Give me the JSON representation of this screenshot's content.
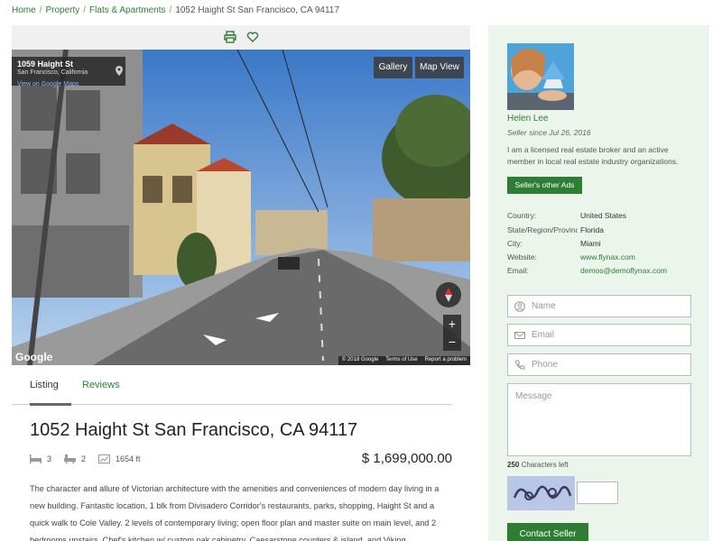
{
  "breadcrumb": {
    "home": "Home",
    "property": "Property",
    "category": "Flats & Apartments",
    "current": "1052 Haight St San Francisco, CA 94117",
    "separator": "/"
  },
  "map": {
    "address_line1": "1059 Haight St",
    "address_line2": "San Francisco, California",
    "view_link": "View on Google Maps",
    "gallery_label": "Gallery",
    "mapview_label": "Map View",
    "zoom_in": "+",
    "zoom_out": "−",
    "logo": "Google",
    "attrib_copyright": "© 2018 Google",
    "attrib_terms": "Terms of Use",
    "attrib_report": "Report a problem"
  },
  "tabs": [
    {
      "label": "Listing",
      "active": true
    },
    {
      "label": "Reviews",
      "active": false
    }
  ],
  "listing": {
    "title": "1052 Haight St San Francisco, CA 94117",
    "beds": "3",
    "baths": "2",
    "area": "1654 ft",
    "price": "$ 1,699,000.00",
    "description": "The character and allure of Victorian architecture with the amenities and conveniences of modern day living in a new building. Fantastic location, 1 blk from Divisadero Corridor's restaurants, parks, shopping, Haight St and a quick walk to Cole Valley. 2 levels of contemporary living; open floor plan and master suite on main level, and 2 bedrooms upstairs. Chef's kitchen w/ custom oak cabinetry, Caesarstone counters & island, and Viking,"
  },
  "seller": {
    "name": "Helen Lee",
    "since": "Seller since Jul 26, 2016",
    "bio": "I am a licensed real estate broker and an active member in local real estate industry organizations.",
    "other_ads_label": "Seller's other Ads",
    "info": [
      {
        "key": "Country:",
        "value": "United States",
        "link": false
      },
      {
        "key": "State/Region/Province:",
        "value": "Florida",
        "link": false
      },
      {
        "key": "City:",
        "value": "Miami",
        "link": false
      },
      {
        "key": "Website:",
        "value": "www.flynax.com",
        "link": true
      },
      {
        "key": "Email:",
        "value": "demos@demoflynax.com",
        "link": true
      }
    ]
  },
  "contact_form": {
    "name_placeholder": "Name",
    "email_placeholder": "Email",
    "phone_placeholder": "Phone",
    "message_placeholder": "Message",
    "chars_count": "250",
    "chars_label": "Characters left",
    "submit_label": "Contact Seller"
  },
  "colors": {
    "accent": "#2e7d32",
    "sidebar_bg": "#ebf5eb"
  }
}
